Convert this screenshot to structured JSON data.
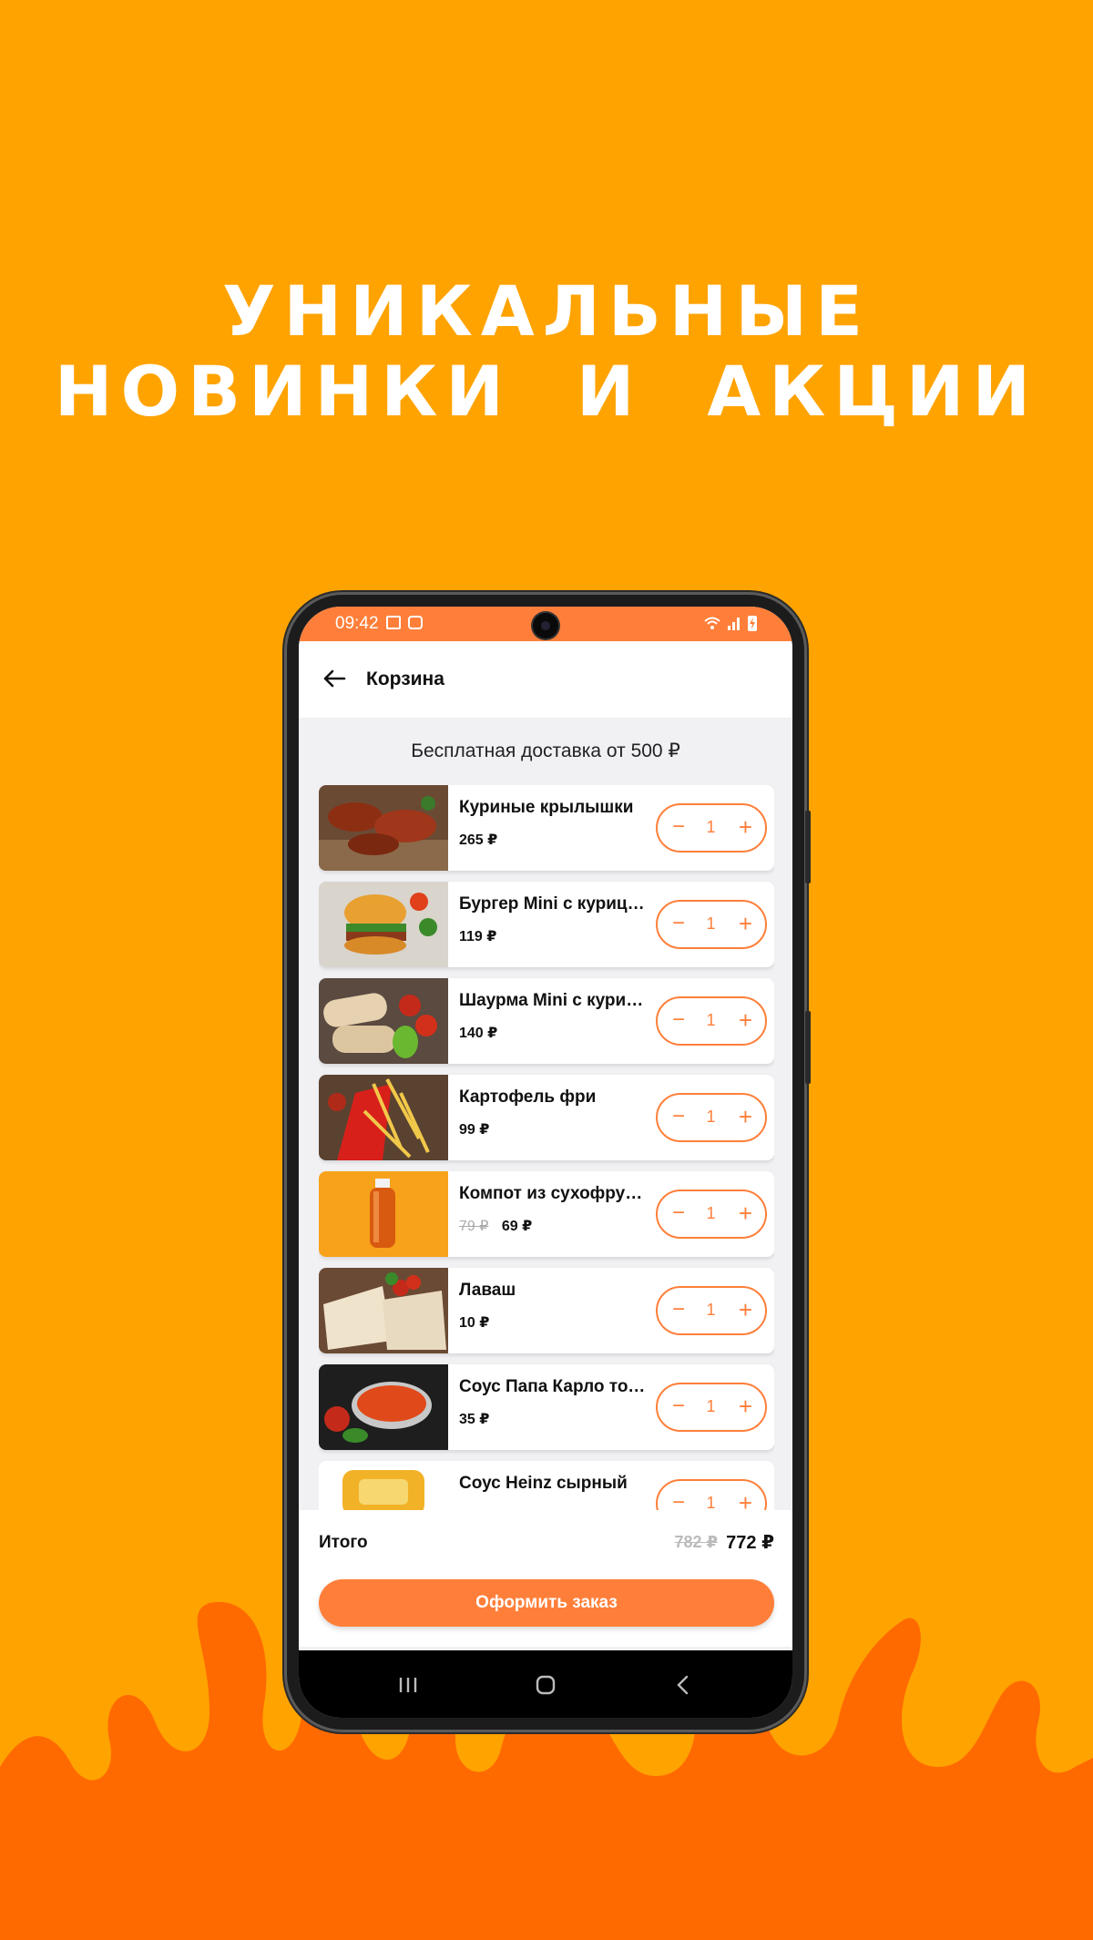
{
  "promo": {
    "headline_line1": "УНИКАЛЬНЫЕ",
    "headline_line2": "НОВИНКИ  И  АКЦИИ"
  },
  "colors": {
    "background": "#FFA300",
    "flames": "#FF6A00",
    "accent": "#FF7F3A"
  },
  "statusbar": {
    "time": "09:42",
    "icons": [
      "image-icon",
      "app-notification-icon",
      "wifi-icon",
      "signal-icon",
      "battery-charging-icon"
    ]
  },
  "appbar": {
    "back_icon": "arrow-left-icon",
    "title": "Корзина"
  },
  "cart": {
    "free_delivery": "Бесплатная доставка от 500 ₽",
    "items": [
      {
        "name": "Куриные крылышки",
        "price": "265 ₽",
        "old_price": "",
        "qty": "1"
      },
      {
        "name": "Бургер Mini с курицей",
        "price": "119 ₽",
        "old_price": "",
        "qty": "1"
      },
      {
        "name": "Шаурма Mini с курицей",
        "price": "140 ₽",
        "old_price": "",
        "qty": "1"
      },
      {
        "name": "Картофель фри",
        "price": "99 ₽",
        "old_price": "",
        "qty": "1"
      },
      {
        "name": "Компот из сухофруктов",
        "price": "69 ₽",
        "old_price": "79 ₽",
        "qty": "1"
      },
      {
        "name": "Лаваш",
        "price": "10 ₽",
        "old_price": "",
        "qty": "1"
      },
      {
        "name": "Соус Папа Карло томатный",
        "price": "35 ₽",
        "old_price": "",
        "qty": "1"
      },
      {
        "name": "Соус Heinz сырный",
        "price": "",
        "old_price": "",
        "qty": "1"
      }
    ],
    "stepper_minus": "−",
    "stepper_plus": "+"
  },
  "summary": {
    "total_label": "Итого",
    "total_old": "782 ₽",
    "total_new": "772 ₽",
    "order_button": "Оформить заказ"
  },
  "navbar": {
    "icons": [
      "recent-apps-icon",
      "home-icon",
      "back-nav-icon"
    ]
  }
}
